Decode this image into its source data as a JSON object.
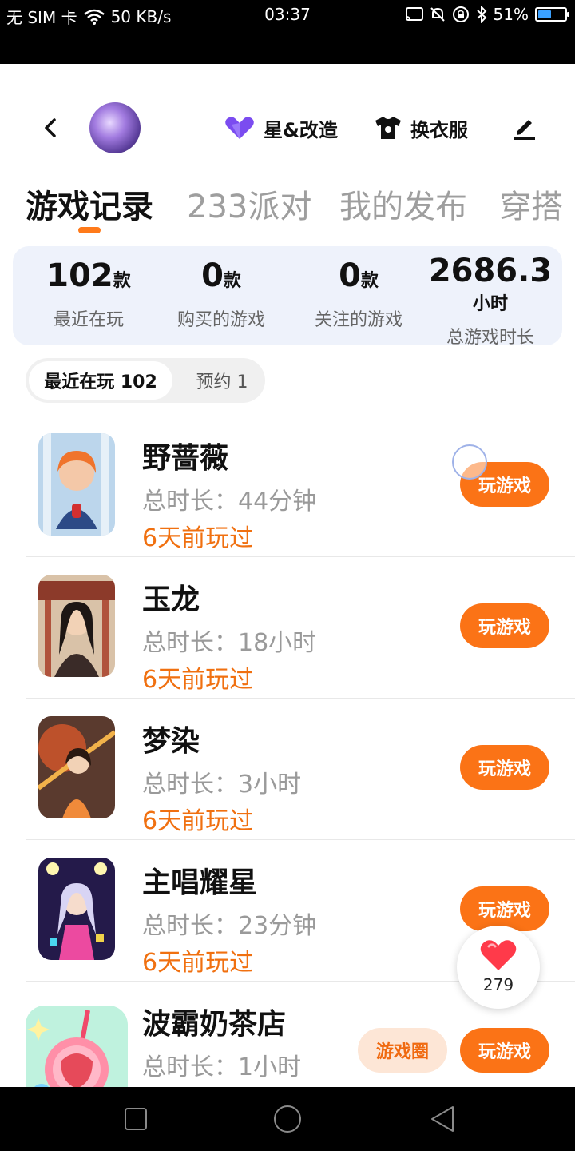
{
  "status_bar": {
    "sim": "无 SIM 卡",
    "speed": "50 KB/s",
    "time": "03:37",
    "battery": "51%",
    "battery_level": 0.51
  },
  "header": {
    "star_label": "星&改造",
    "clothes_label": "换衣服"
  },
  "tabs": [
    {
      "label": "游戏记录"
    },
    {
      "label": "233派对"
    },
    {
      "label": "我的发布"
    },
    {
      "label": "穿搭"
    }
  ],
  "stats": [
    {
      "value": "102",
      "unit": "款",
      "label": "最近在玩"
    },
    {
      "value": "0",
      "unit": "款",
      "label": "购买的游戏"
    },
    {
      "value": "0",
      "unit": "款",
      "label": "关注的游戏"
    },
    {
      "value": "2686.3",
      "unit": "小时",
      "label": "总游戏时长"
    }
  ],
  "subtabs": {
    "recent": "最近在玩 102",
    "reserve": "预约 1"
  },
  "games": [
    {
      "title": "野蔷薇",
      "duration": "总时长：44分钟",
      "last_played": "6天前玩过",
      "play_label": "玩游戏"
    },
    {
      "title": "玉龙",
      "duration": "总时长：18小时",
      "last_played": "6天前玩过",
      "play_label": "玩游戏"
    },
    {
      "title": "梦染",
      "duration": "总时长：3小时",
      "last_played": "6天前玩过",
      "play_label": "玩游戏"
    },
    {
      "title": "主唱耀星",
      "duration": "总时长：23分钟",
      "last_played": "6天前玩过",
      "play_label": "玩游戏"
    },
    {
      "title": "波霸奶茶店",
      "duration": "总时长：1小时",
      "circle_label": "游戏圈",
      "play_label": "玩游戏"
    }
  ],
  "like": {
    "count": "279"
  },
  "colors": {
    "accent": "#fb7316",
    "last_played": "#f07010",
    "stats_bg": "#eef2fb"
  }
}
